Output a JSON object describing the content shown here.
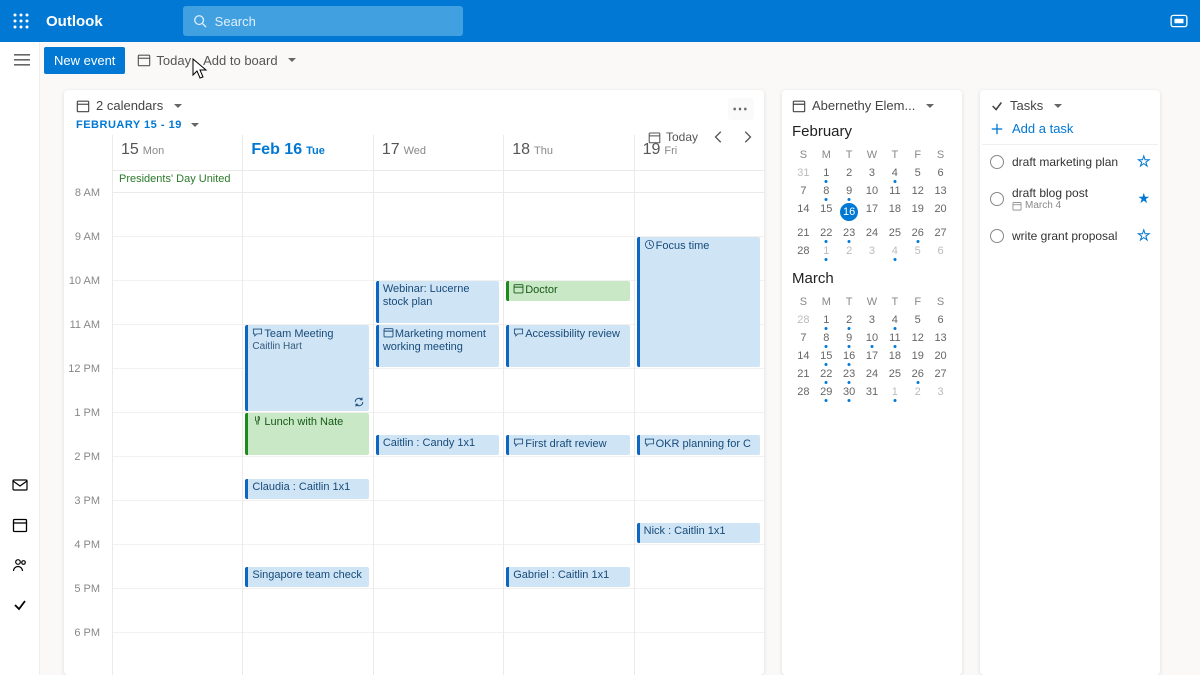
{
  "header": {
    "app_name": "Outlook",
    "search_placeholder": "Search"
  },
  "cmdbar": {
    "new_event": "New event",
    "today": "Today",
    "add_to_board": "Add to board"
  },
  "calendar_card": {
    "selector_label": "2 calendars",
    "range": "FEBRUARY 15 - 19",
    "today_label": "Today",
    "hours": [
      "8 AM",
      "9 AM",
      "10 AM",
      "11 AM",
      "12 PM",
      "1 PM",
      "2 PM",
      "3 PM",
      "4 PM",
      "5 PM",
      "6 PM"
    ],
    "days": [
      {
        "num": "15",
        "dow": "Mon",
        "today": false,
        "allday": "Presidents' Day United",
        "events": []
      },
      {
        "num": "Feb 16",
        "dow": "Tue",
        "today": true,
        "allday": "",
        "events": [
          {
            "start": 3,
            "dur": 2,
            "kind": "blue",
            "icon": "chat",
            "title": "Team Meeting",
            "sub": "Caitlin Hart",
            "recurring": true
          },
          {
            "start": 5,
            "dur": 1,
            "kind": "green",
            "icon": "fork",
            "title": "Lunch with Nate"
          },
          {
            "start": 6.5,
            "dur": 0.5,
            "kind": "blue",
            "title": "Claudia : Caitlin 1x1"
          },
          {
            "start": 8.5,
            "dur": 0.5,
            "kind": "blue",
            "title": "Singapore team check"
          }
        ]
      },
      {
        "num": "17",
        "dow": "Wed",
        "today": false,
        "allday": "",
        "events": [
          {
            "start": 2,
            "dur": 1,
            "kind": "blue",
            "title": "Webinar: Lucerne stock plan"
          },
          {
            "start": 3,
            "dur": 1,
            "kind": "blue",
            "icon": "calendar",
            "title": "Marketing moment working meeting"
          },
          {
            "start": 5.5,
            "dur": 0.5,
            "kind": "blue",
            "title": "Caitlin : Candy 1x1"
          }
        ]
      },
      {
        "num": "18",
        "dow": "Thu",
        "today": false,
        "allday": "",
        "events": [
          {
            "start": 2,
            "dur": 0.5,
            "kind": "green",
            "icon": "calendar",
            "title": "Doctor"
          },
          {
            "start": 3,
            "dur": 1,
            "kind": "blue",
            "icon": "chat",
            "title": "Accessibility review"
          },
          {
            "start": 5.5,
            "dur": 0.5,
            "kind": "blue",
            "icon": "chat",
            "title": "First draft review"
          },
          {
            "start": 8.5,
            "dur": 0.5,
            "kind": "blue",
            "title": "Gabriel : Caitlin 1x1"
          }
        ]
      },
      {
        "num": "19",
        "dow": "Fri",
        "today": false,
        "allday": "",
        "events": [
          {
            "start": 1,
            "dur": 3,
            "kind": "blue",
            "icon": "clock",
            "title": "Focus time"
          },
          {
            "start": 5.5,
            "dur": 0.5,
            "kind": "blue",
            "icon": "chat",
            "title": "OKR planning for C"
          },
          {
            "start": 7.5,
            "dur": 0.5,
            "kind": "blue",
            "title": "Nick : Caitlin 1x1"
          }
        ]
      }
    ]
  },
  "mini_cal": {
    "selector_label": "Abernethy Elem...",
    "months": [
      {
        "name": "February",
        "dow": [
          "S",
          "M",
          "T",
          "W",
          "T",
          "F",
          "S"
        ],
        "weeks": [
          [
            {
              "d": "31",
              "m": true
            },
            {
              "d": "1",
              "dot": true
            },
            {
              "d": "2"
            },
            {
              "d": "3"
            },
            {
              "d": "4",
              "dot": true
            },
            {
              "d": "5"
            },
            {
              "d": "6"
            }
          ],
          [
            {
              "d": "7"
            },
            {
              "d": "8",
              "dot": true
            },
            {
              "d": "9",
              "dot": true
            },
            {
              "d": "10"
            },
            {
              "d": "11"
            },
            {
              "d": "12"
            },
            {
              "d": "13"
            }
          ],
          [
            {
              "d": "14"
            },
            {
              "d": "15"
            },
            {
              "d": "16",
              "today": true
            },
            {
              "d": "17"
            },
            {
              "d": "18"
            },
            {
              "d": "19"
            },
            {
              "d": "20"
            }
          ],
          [
            {
              "d": "21"
            },
            {
              "d": "22",
              "dot": true
            },
            {
              "d": "23",
              "dot": true
            },
            {
              "d": "24"
            },
            {
              "d": "25"
            },
            {
              "d": "26",
              "dot": true
            },
            {
              "d": "27"
            }
          ],
          [
            {
              "d": "28"
            },
            {
              "d": "1",
              "m": true,
              "dot": true
            },
            {
              "d": "2",
              "m": true
            },
            {
              "d": "3",
              "m": true
            },
            {
              "d": "4",
              "m": true,
              "dot": true
            },
            {
              "d": "5",
              "m": true
            },
            {
              "d": "6",
              "m": true
            }
          ]
        ]
      },
      {
        "name": "March",
        "dow": [
          "S",
          "M",
          "T",
          "W",
          "T",
          "F",
          "S"
        ],
        "weeks": [
          [
            {
              "d": "28",
              "m": true
            },
            {
              "d": "1",
              "dot": true
            },
            {
              "d": "2",
              "dot": true
            },
            {
              "d": "3"
            },
            {
              "d": "4",
              "dot": true
            },
            {
              "d": "5"
            },
            {
              "d": "6"
            }
          ],
          [
            {
              "d": "7"
            },
            {
              "d": "8",
              "dot": true
            },
            {
              "d": "9",
              "dot": true
            },
            {
              "d": "10",
              "dot": true
            },
            {
              "d": "11",
              "dot": true
            },
            {
              "d": "12"
            },
            {
              "d": "13"
            }
          ],
          [
            {
              "d": "14"
            },
            {
              "d": "15",
              "dot": true
            },
            {
              "d": "16",
              "dot": true
            },
            {
              "d": "17"
            },
            {
              "d": "18"
            },
            {
              "d": "19"
            },
            {
              "d": "20"
            }
          ],
          [
            {
              "d": "21"
            },
            {
              "d": "22",
              "dot": true
            },
            {
              "d": "23",
              "dot": true
            },
            {
              "d": "24"
            },
            {
              "d": "25"
            },
            {
              "d": "26",
              "dot": true
            },
            {
              "d": "27"
            }
          ],
          [
            {
              "d": "28"
            },
            {
              "d": "29",
              "dot": true
            },
            {
              "d": "30",
              "dot": true
            },
            {
              "d": "31"
            },
            {
              "d": "1",
              "m": true,
              "dot": true
            },
            {
              "d": "2",
              "m": true
            },
            {
              "d": "3",
              "m": true
            }
          ]
        ]
      }
    ]
  },
  "tasks_card": {
    "title": "Tasks",
    "add_label": "Add a task",
    "items": [
      {
        "title": "draft marketing plan",
        "star": "outline"
      },
      {
        "title": "draft blog post",
        "due": "March 4",
        "star": "solid"
      },
      {
        "title": "write grant proposal",
        "star": "outline"
      }
    ]
  }
}
